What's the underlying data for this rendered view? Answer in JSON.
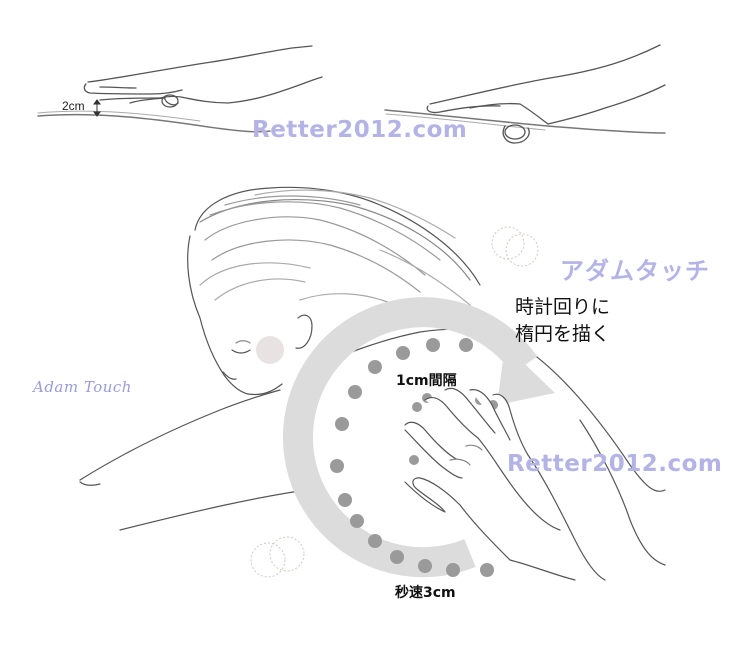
{
  "labels": {
    "height": "2cm",
    "title_jp": "アダムタッチ",
    "instruction_line1": "時計回りに",
    "instruction_line2": "楕円を描く",
    "dot_spacing": "1cm間隔",
    "speed": "秒速3cm",
    "script_title": "Adam Touch"
  },
  "watermarks": {
    "top": "Retter2012.com",
    "right": "Retter2012.com"
  },
  "icons": {
    "hand_near": "hand-hover-icon",
    "hand_touch": "hand-touch-icon",
    "figure": "lying-woman-figure",
    "arrow": "clockwise-circle-arrow",
    "ring": "double-ring-icon"
  },
  "colors": {
    "line": "#555555",
    "arrow_band": "#d9d9d9",
    "dots": "#9a9a9a",
    "watermark": "#b3b3e6",
    "ring": "#d0c7c0"
  }
}
